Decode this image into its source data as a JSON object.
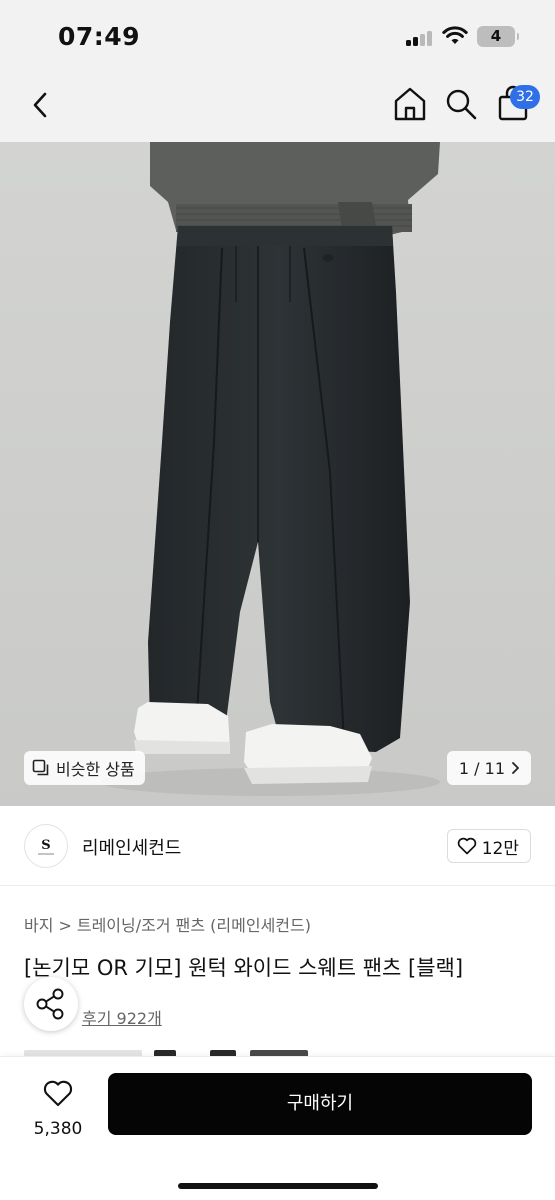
{
  "status_bar": {
    "time": "07:49",
    "battery": "4"
  },
  "header": {
    "back_icon": "chevron-left-icon",
    "home_icon": "home-icon",
    "search_icon": "search-icon",
    "cart_icon": "shopping-bag-icon",
    "cart_count": "32",
    "badge_color": "#2f6fe8"
  },
  "gallery": {
    "similar_label": "비슷한 상품",
    "current": "1",
    "total": "11",
    "counter_text": "1 / 11"
  },
  "brand": {
    "name": "리메인세컨드",
    "likes": "12만",
    "like_icon": "heart-icon"
  },
  "product": {
    "breadcrumb": [
      "바지",
      "트레이닝/조거 팬츠 (리메인세컨드)"
    ],
    "title": "[논기모 OR 기모] 원턱 와이드 스웨트 팬츠 [블랙]",
    "reviews": "후기 922개",
    "share_icon": "share-icon"
  },
  "bottom_bar": {
    "wish_icon": "heart-icon",
    "wish_count": "5,380",
    "buy_label": "구매하기",
    "buy_color": "#050505"
  }
}
